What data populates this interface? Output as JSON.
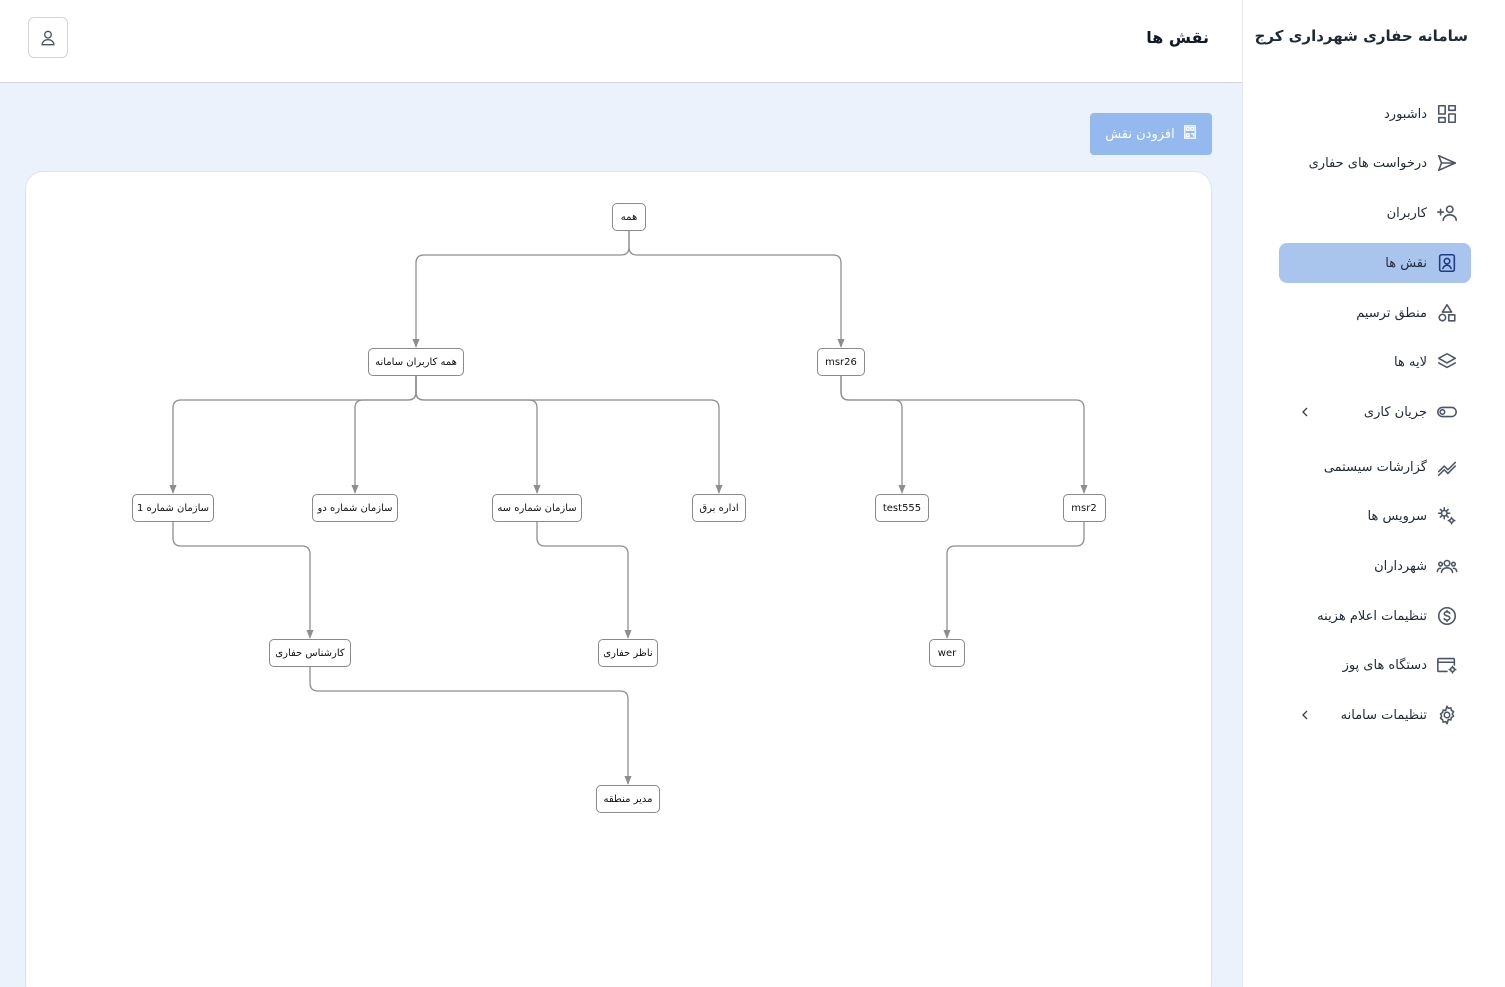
{
  "app": {
    "title": "سامانه حفاری شهرداری کرج"
  },
  "header": {
    "title": "نقش ها",
    "user_icon": "user-icon"
  },
  "toolbar": {
    "add_role_label": "افزودن نقش",
    "add_role_icon": "qrcode-icon"
  },
  "sidebar": {
    "active_color": "#a9c5ee",
    "items": [
      {
        "label": "داشبورد",
        "icon": "dashboard-icon"
      },
      {
        "label": "درخواست های حفاری",
        "icon": "send-icon"
      },
      {
        "label": "کاربران",
        "icon": "users-icon"
      },
      {
        "label": "نقش ها",
        "icon": "id-badge-icon",
        "active": true
      },
      {
        "label": "منطق ترسیم",
        "icon": "shapes-icon"
      },
      {
        "label": "لایه ها",
        "icon": "layers-icon"
      },
      {
        "label": "جریان کاری",
        "icon": "toggle-icon",
        "has_submenu": true
      },
      {
        "label": "گزارشات سیستمی",
        "icon": "trend-icon"
      },
      {
        "label": "سرویس ها",
        "icon": "gears-icon"
      },
      {
        "label": "شهرداران",
        "icon": "group-icon"
      },
      {
        "label": "تنظیمات اعلام هزینه",
        "icon": "dollar-icon"
      },
      {
        "label": "دستگاه های پوز",
        "icon": "card-gear-icon"
      },
      {
        "label": "تنظیمات سامانه",
        "icon": "settings-icon",
        "has_submenu": true
      }
    ]
  },
  "role_tree": {
    "nodes": [
      {
        "id": "all",
        "label": "همه"
      },
      {
        "id": "all_users",
        "label": "همه کاربران سامانه"
      },
      {
        "id": "msr26",
        "label": "msr26"
      },
      {
        "id": "org1",
        "label": "سازمان شماره 1"
      },
      {
        "id": "org2",
        "label": "سازمان شماره دو"
      },
      {
        "id": "org3",
        "label": "سازمان شماره سه"
      },
      {
        "id": "power",
        "label": "اداره برق"
      },
      {
        "id": "test555",
        "label": "test555"
      },
      {
        "id": "msr2",
        "label": "msr2"
      },
      {
        "id": "expert",
        "label": "کارشناس حفاری"
      },
      {
        "id": "supervisor",
        "label": "ناظر حفاری"
      },
      {
        "id": "wer",
        "label": "wer"
      },
      {
        "id": "manager",
        "label": "مدیر منطقه"
      }
    ],
    "edges": [
      [
        "all",
        "all_users"
      ],
      [
        "all",
        "msr26"
      ],
      [
        "all_users",
        "org1"
      ],
      [
        "all_users",
        "org2"
      ],
      [
        "all_users",
        "org3"
      ],
      [
        "all_users",
        "power"
      ],
      [
        "msr26",
        "test555"
      ],
      [
        "msr26",
        "msr2"
      ],
      [
        "org1",
        "expert"
      ],
      [
        "org3",
        "supervisor"
      ],
      [
        "msr2",
        "wer"
      ],
      [
        "expert",
        "manager"
      ]
    ]
  }
}
